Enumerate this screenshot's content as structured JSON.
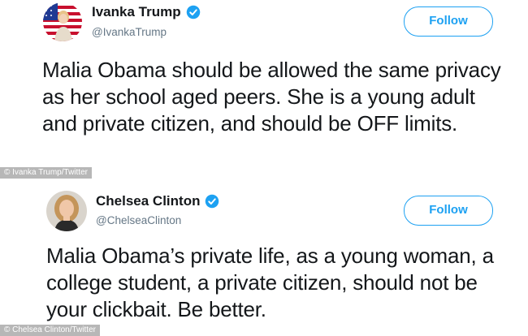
{
  "colors": {
    "accent": "#1da1f2",
    "text": "#14171a",
    "muted": "#657786",
    "credit_bg": "#b7b7b7"
  },
  "tweets": [
    {
      "display_name": "Ivanka Trump",
      "handle": "@IvankaTrump",
      "verified": true,
      "avatar_icon": "avatar-ivanka-trump",
      "follow_label": "Follow",
      "text": "Malia Obama should be allowed the same privacy as her school aged peers. She is a young adult and private citizen, and should be OFF limits.",
      "credit": "© Ivanka Trump/Twitter"
    },
    {
      "display_name": "Chelsea Clinton",
      "handle": "@ChelseaClinton",
      "verified": true,
      "avatar_icon": "avatar-chelsea-clinton",
      "follow_label": "Follow",
      "text": "Malia Obama’s private life, as a young woman, a college student, a private citizen, should not be your clickbait. Be better.",
      "credit": "© Chelsea Clinton/Twitter"
    }
  ]
}
